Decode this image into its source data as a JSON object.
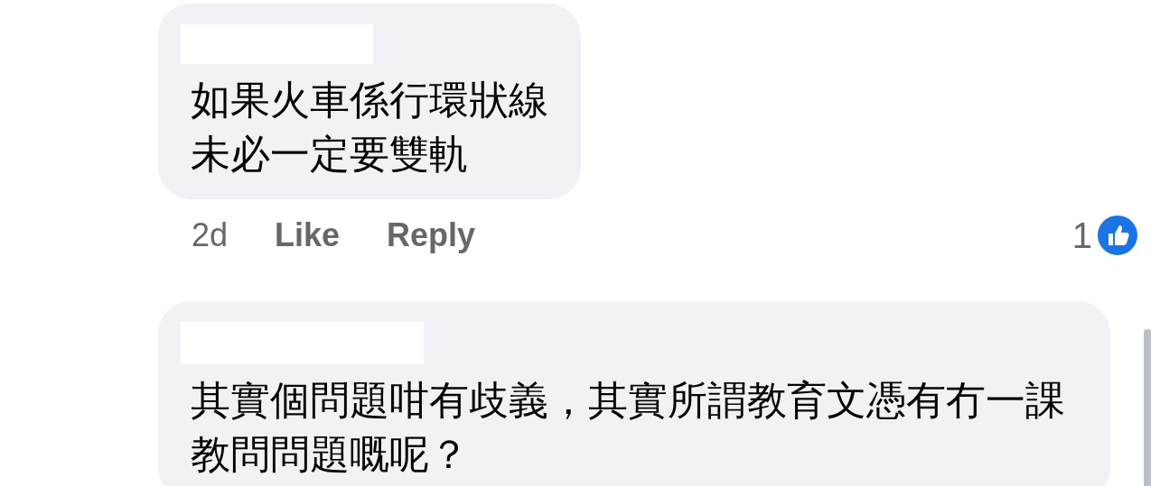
{
  "comments": [
    {
      "lines": [
        "如果火車係行環狀線",
        "未必一定要雙軌"
      ],
      "time": "2d",
      "actions": [
        "Like",
        "Reply"
      ],
      "reaction_count": "1"
    },
    {
      "lines": [
        "其實個問題咁有歧義，其實所謂教育文憑有冇一課",
        "教問問題嘅呢？"
      ]
    }
  ]
}
